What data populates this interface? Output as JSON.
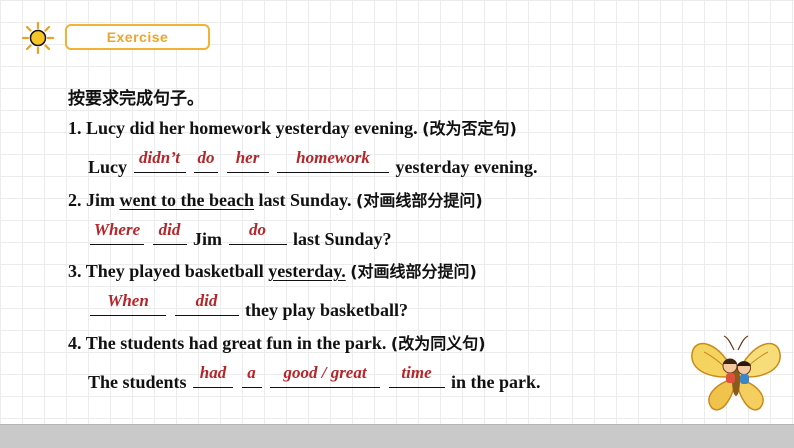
{
  "header": {
    "badge_label": "Exercise",
    "sun_icon": "sun-icon"
  },
  "instruction": "按要求完成句子。",
  "questions": [
    {
      "number": "1.",
      "sentence": "Lucy did her homework yesterday evening.",
      "task": "(改为否定句)",
      "answer_prefix": "Lucy",
      "answers": [
        "didn’t",
        "do",
        "her",
        "homework"
      ],
      "answer_suffix": "yesterday evening."
    },
    {
      "number": "2.",
      "sentence_pre": "Jim",
      "underlined": "went to the beach",
      "sentence_post": "last Sunday.",
      "task": "(对画线部分提问)",
      "answers": [
        "Where",
        "did",
        "do"
      ],
      "mid_word": "Jim",
      "answer_suffix": "last Sunday?"
    },
    {
      "number": "3.",
      "sentence_pre": "They played basketball",
      "underlined": "yesterday.",
      "task": "(对画线部分提问)",
      "answers": [
        "When",
        "did"
      ],
      "answer_suffix": "they play basketball?"
    },
    {
      "number": "4.",
      "sentence": "The students had great fun in the park.",
      "task": "(改为同义句)",
      "answer_prefix": "The students",
      "answers": [
        "had",
        "a",
        "good / great",
        "time"
      ],
      "answer_suffix": "in the park."
    }
  ],
  "colors": {
    "accent": "#f2b233",
    "answer": "#b3262a",
    "footer": "#c9c9c9"
  },
  "decoration": {
    "butterfly": "butterfly-kids-illustration"
  }
}
